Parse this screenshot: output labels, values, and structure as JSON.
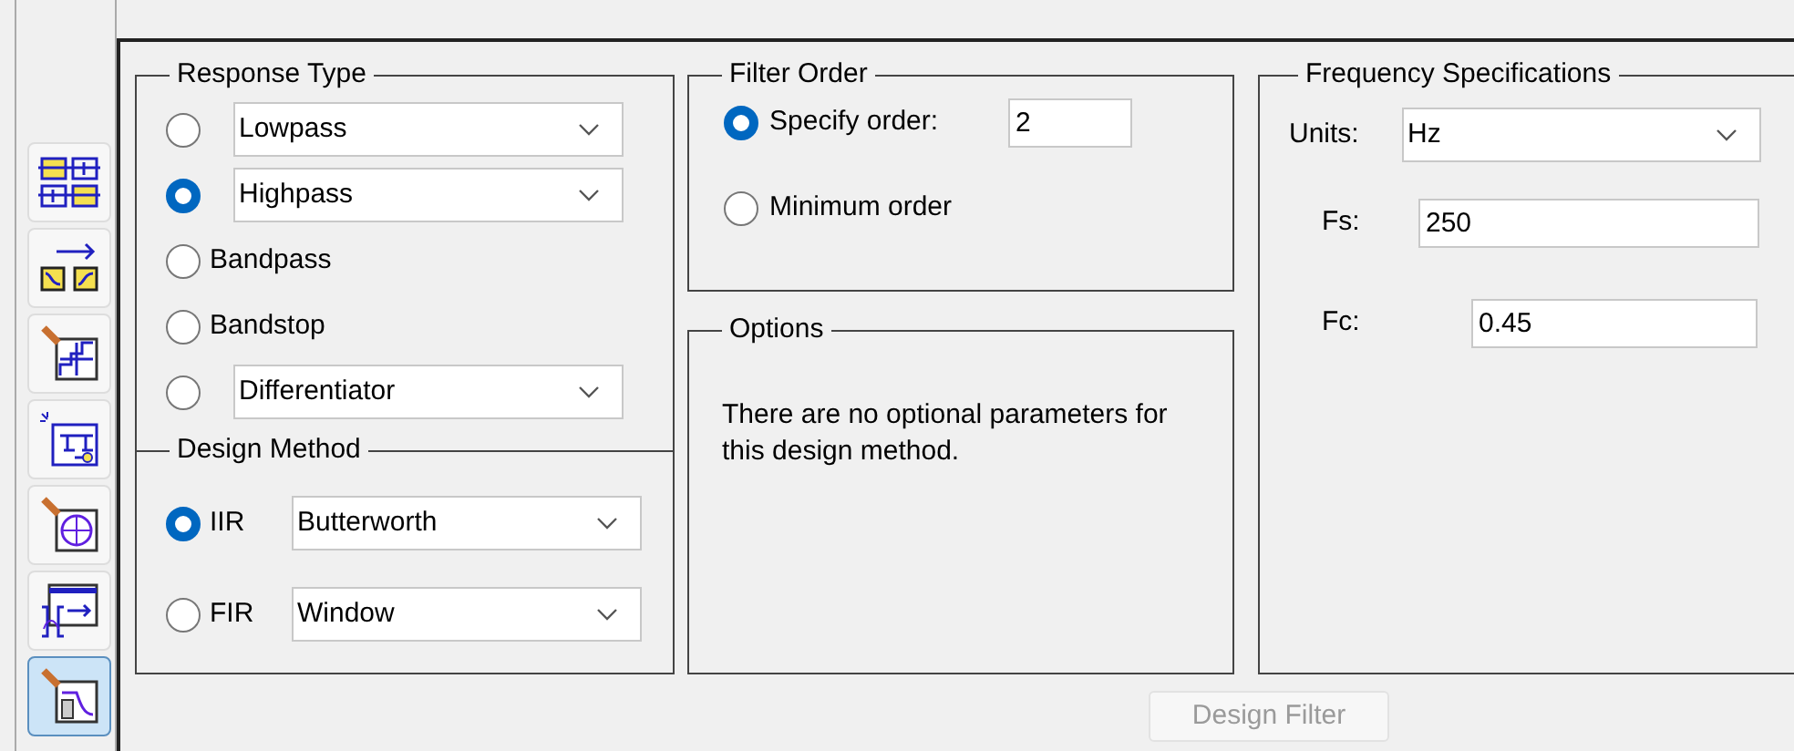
{
  "toolbar": [
    {
      "kind": "blocks",
      "selected": false
    },
    {
      "kind": "convert",
      "selected": false
    },
    {
      "kind": "stairs",
      "selected": false
    },
    {
      "kind": "diagram",
      "selected": false
    },
    {
      "kind": "polezero",
      "selected": false
    },
    {
      "kind": "coeffs",
      "selected": false
    },
    {
      "kind": "design",
      "selected": true
    }
  ],
  "response_type": {
    "title": "Response Type",
    "options": [
      {
        "kind": "dropdown",
        "value": "Lowpass",
        "selected": false
      },
      {
        "kind": "dropdown",
        "value": "Highpass",
        "selected": true
      },
      {
        "kind": "label",
        "label": "Bandpass",
        "selected": false
      },
      {
        "kind": "label",
        "label": "Bandstop",
        "selected": false
      },
      {
        "kind": "dropdown",
        "value": "Differentiator",
        "selected": false
      }
    ]
  },
  "design_method": {
    "title": "Design Method",
    "options": [
      {
        "label": "IIR",
        "value": "Butterworth",
        "selected": true
      },
      {
        "label": "FIR",
        "value": "Window",
        "selected": false
      }
    ]
  },
  "filter_order": {
    "title": "Filter Order",
    "options": [
      {
        "kind": "input",
        "label": "Specify order:",
        "value": "2",
        "selected": true
      },
      {
        "kind": "label",
        "label": "Minimum order",
        "selected": false
      }
    ]
  },
  "options": {
    "title": "Options",
    "message": "There are no optional parameters for this design method."
  },
  "frequency_specifications": {
    "title": "Frequency Specifications",
    "fields": [
      {
        "kind": "dropdown",
        "label": "Units:",
        "value": "Hz"
      },
      {
        "kind": "input",
        "label": "Fs:",
        "value": "250"
      },
      {
        "kind": "input",
        "label": "Fc:",
        "value": "0.45"
      }
    ]
  },
  "design_button": {
    "label": "Design Filter",
    "disabled": true
  }
}
